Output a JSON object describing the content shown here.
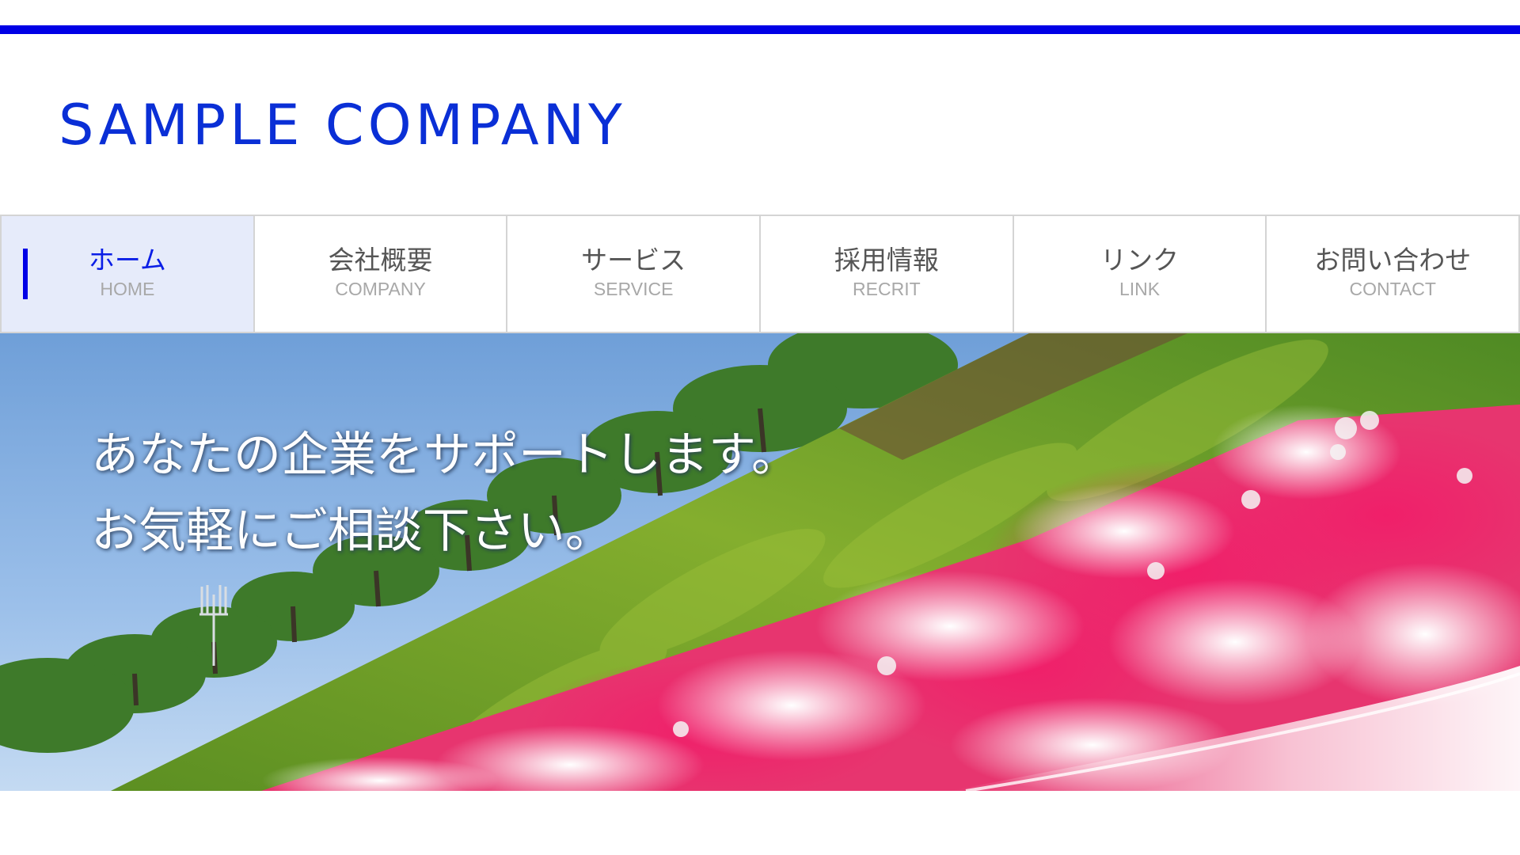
{
  "header": {
    "logo_text": "SAMPLE COMPANY"
  },
  "nav": {
    "items": [
      {
        "label": "ホーム",
        "sub": "HOME",
        "active": true
      },
      {
        "label": "会社概要",
        "sub": "COMPANY",
        "active": false
      },
      {
        "label": "サービス",
        "sub": "SERVICE",
        "active": false
      },
      {
        "label": "採用情報",
        "sub": "RECRIT",
        "active": false
      },
      {
        "label": "リンク",
        "sub": "LINK",
        "active": false
      },
      {
        "label": "お問い合わせ",
        "sub": "CONTACT",
        "active": false
      }
    ]
  },
  "hero": {
    "line1": "あなたの企業をサポートします。",
    "line2": "お気軽にご相談下さい。"
  },
  "colors": {
    "accent": "#0000e6",
    "logo": "#0a2fd6",
    "active_nav_bg": "#e6ebfa",
    "nav_text": "#555555",
    "nav_sub_text": "#a8a8a8"
  }
}
